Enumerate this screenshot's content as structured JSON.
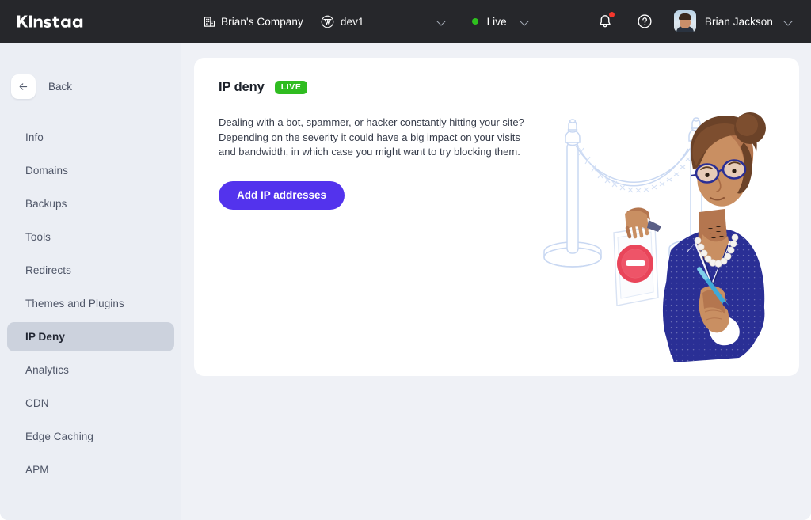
{
  "topbar": {
    "logo_text": "Kinsta",
    "company": {
      "icon": "building-icon",
      "label": "Brian's Company"
    },
    "site": {
      "icon": "wordpress-icon",
      "label": "dev1"
    },
    "env_chevron_icon": "chevron-down-icon",
    "environment": {
      "status_dot_color": "#2ec11e",
      "label": "Live",
      "chevron_icon": "chevron-down-icon"
    },
    "notifications": {
      "icon": "bell-icon",
      "badge_color": "#f4372d",
      "has_unread": true
    },
    "help": {
      "icon": "question-circle-icon"
    },
    "user": {
      "avatar": "user-avatar",
      "name": "Brian Jackson",
      "chevron_icon": "chevron-down-icon"
    }
  },
  "sidebar": {
    "back": {
      "icon": "arrow-left-icon",
      "label": "Back"
    },
    "items": [
      {
        "label": "Info",
        "active": false
      },
      {
        "label": "Domains",
        "active": false
      },
      {
        "label": "Backups",
        "active": false
      },
      {
        "label": "Tools",
        "active": false
      },
      {
        "label": "Redirects",
        "active": false
      },
      {
        "label": "Themes and Plugins",
        "active": false
      },
      {
        "label": "IP Deny",
        "active": true
      },
      {
        "label": "Analytics",
        "active": false
      },
      {
        "label": "CDN",
        "active": false
      },
      {
        "label": "Edge Caching",
        "active": false
      },
      {
        "label": "APM",
        "active": false
      }
    ]
  },
  "main": {
    "card": {
      "title": "IP deny",
      "badge": {
        "label": "LIVE",
        "color": "#2fbc20"
      },
      "description": "Dealing with a bot, spammer, or hacker constantly hitting your site? Depending on the severity it could have a big impact on your visits and bandwidth, in which case you might want to try blocking them.",
      "primary_button": {
        "label": "Add IP addresses",
        "color": "#5333ed"
      },
      "illustration": "woman-blocking-entry-with-no-entry-sign-and-stanchion-rope"
    }
  },
  "colors": {
    "topbar_bg": "#26272b",
    "sidebar_bg": "#ebeef4",
    "page_bg": "#eff1f6",
    "card_bg": "#ffffff",
    "accent": "#5333ed",
    "active_nav_bg": "#ccd2dd"
  }
}
